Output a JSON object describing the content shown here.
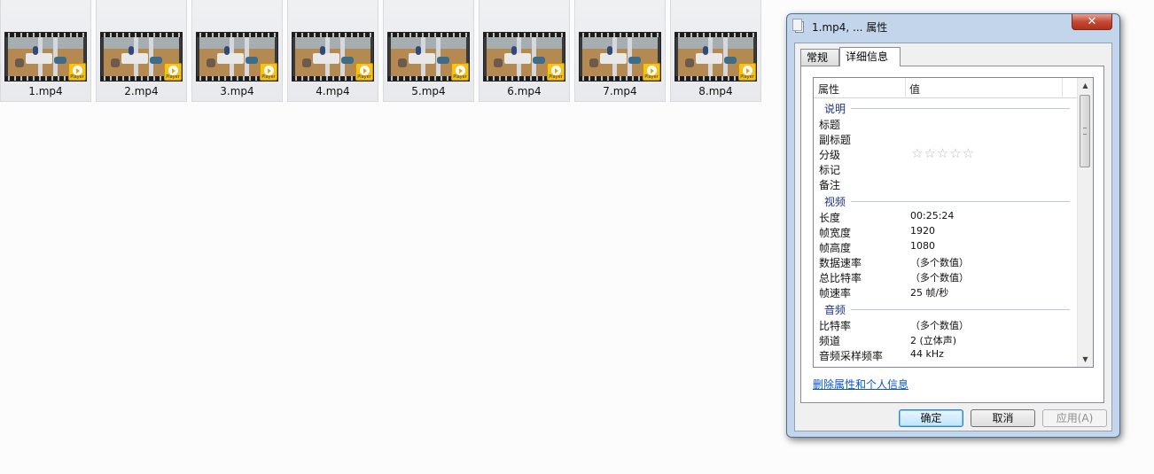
{
  "files": [
    {
      "name": "1.mp4",
      "badge": "Player"
    },
    {
      "name": "2.mp4",
      "badge": "Player"
    },
    {
      "name": "3.mp4",
      "badge": "Player"
    },
    {
      "name": "4.mp4",
      "badge": "Player"
    },
    {
      "name": "5.mp4",
      "badge": "Player"
    },
    {
      "name": "6.mp4",
      "badge": "Player"
    },
    {
      "name": "7.mp4",
      "badge": "Player"
    },
    {
      "name": "8.mp4",
      "badge": "Player"
    }
  ],
  "dialog": {
    "title": "1.mp4, ... 属性",
    "close_label": "✕",
    "tabs": [
      {
        "label": "常规",
        "active": false
      },
      {
        "label": "详细信息",
        "active": true
      }
    ],
    "columns": {
      "property": "属性",
      "value": "值"
    },
    "sections": {
      "description": {
        "label": "说明",
        "rows": [
          {
            "key": "标题",
            "value": ""
          },
          {
            "key": "副标题",
            "value": ""
          },
          {
            "key": "分级",
            "value": "☆☆☆☆☆"
          },
          {
            "key": "标记",
            "value": ""
          },
          {
            "key": "备注",
            "value": ""
          }
        ]
      },
      "video": {
        "label": "视频",
        "rows": [
          {
            "key": "长度",
            "value": "00:25:24"
          },
          {
            "key": "帧宽度",
            "value": "1920"
          },
          {
            "key": "帧高度",
            "value": "1080"
          },
          {
            "key": "数据速率",
            "value": "（多个数值）"
          },
          {
            "key": "总比特率",
            "value": "（多个数值）"
          },
          {
            "key": "帧速率",
            "value": "25 帧/秒"
          }
        ]
      },
      "audio": {
        "label": "音频",
        "rows": [
          {
            "key": "比特率",
            "value": "（多个数值）"
          },
          {
            "key": "频道",
            "value": "2 (立体声)"
          },
          {
            "key": "音频采样频率",
            "value": "44 kHz"
          }
        ]
      }
    },
    "remove_link": "删除属性和个人信息",
    "buttons": {
      "ok": "确定",
      "cancel": "取消",
      "apply": "应用(A)"
    },
    "scroll_up": "▲",
    "scroll_down": "▼"
  }
}
